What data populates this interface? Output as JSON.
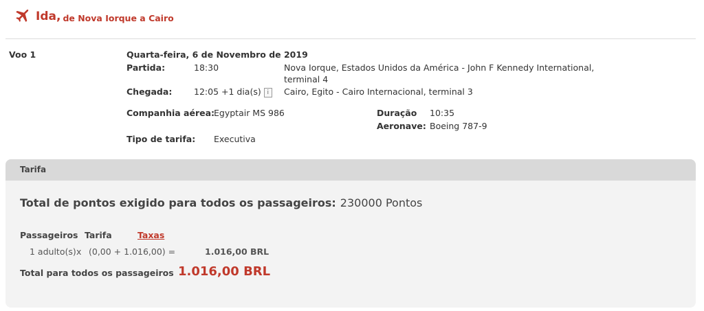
{
  "header": {
    "title": "Ida,",
    "subtitle": "de Nova Iorque a Cairo",
    "icon": "plane-icon"
  },
  "flight": {
    "label": "Voo 1",
    "date": "Quarta-feira, 6 de Novembro de 2019",
    "departure": {
      "label": "Partida:",
      "time": "18:30",
      "place_line1": "Nova Iorque, Estados Unidos da América - John F Kennedy International,",
      "place_line2": "terminal 4"
    },
    "arrival": {
      "label": "Chegada:",
      "time": "12:05 +1 dia(s)",
      "info_icon": "i",
      "place": "Cairo, Egito - Cairo Internacional, terminal 3"
    },
    "airline": {
      "label": "Companhia aérea:",
      "value": "Egyptair MS 986"
    },
    "duration": {
      "label": "Duração",
      "value": "10:35"
    },
    "aircraft": {
      "label": "Aeronave:",
      "value": "Boeing 787-9"
    },
    "fare_type": {
      "label": "Tipo de tarifa:",
      "value": "Executiva"
    }
  },
  "fare": {
    "heading": "Tarifa",
    "points_label": "Total de pontos exigido para todos os passageiros:",
    "points_value": "230000 Pontos",
    "columns": {
      "passengers": "Passageiros",
      "fare": "Tarifa",
      "taxes": "Taxas"
    },
    "row": {
      "passengers": "1 adulto(s)",
      "times": "x",
      "formula": "(0,00 + 1.016,00) =",
      "total": "1.016,00 BRL"
    },
    "grand_total_label": "Total para todos os passageiros",
    "grand_total_value": "1.016,00 BRL"
  }
}
